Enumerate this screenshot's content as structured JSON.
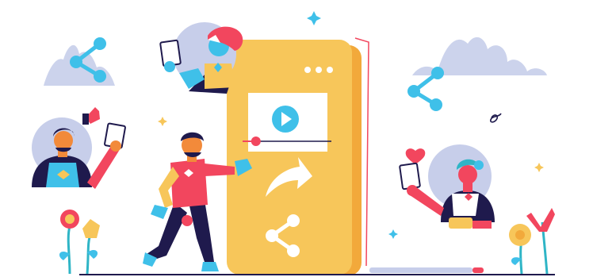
{
  "illustration": {
    "subject": "video-sharing-social-media",
    "icons": [
      "share-icon",
      "play-icon",
      "forward-arrow-icon",
      "heart-icon",
      "menu-dots-icon",
      "sparkle-icon"
    ],
    "colors": {
      "phone_body": "#F7C65A",
      "phone_shadow": "#F2A93B",
      "accent_blue": "#3FC0E9",
      "accent_red": "#F2465E",
      "navy": "#1F1A4D",
      "lavender": "#C7CEEA",
      "skin_orange": "#F28A3A",
      "teal": "#2FB5C6",
      "white": "#FFFFFF"
    },
    "video_progress": 0.15
  }
}
